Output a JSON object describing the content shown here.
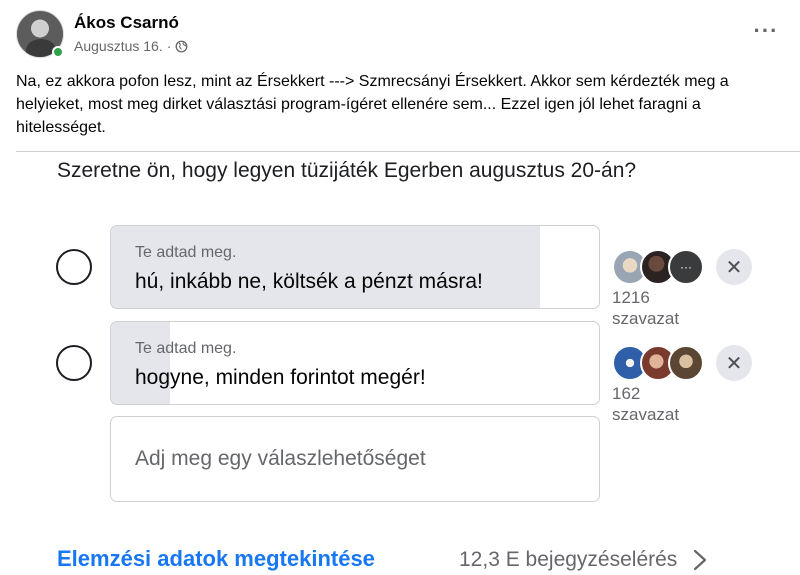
{
  "post": {
    "author": "Ákos Csarnó",
    "date": "Augusztus 16.",
    "date_separator": "·",
    "privacy_icon": "globe-icon",
    "more_label": "···",
    "text": "Na, ez akkora pofon lesz, mint az Érsekkert ---> Szmrecsányi Érsekkert. Akkor sem kérdezték meg a helyieket, most meg dirket választási program-ígéret ellenére sem... Ezzel igen jól lehet faragni a hitelességet."
  },
  "poll": {
    "question": "Szeretne ön, hogy legyen tüzijáték Egerben augusztus 20-án?",
    "options": [
      {
        "added_by": "Te adtad meg.",
        "text": "hú, inkább ne, költsék a pénzt másra!",
        "votes": "1216",
        "votes_label": "szavazat",
        "vote_share": 0.88,
        "remove_label": "✕"
      },
      {
        "added_by": "Te adtad meg.",
        "text": "hogyne, minden forintot megér!",
        "votes": "162",
        "votes_label": "szavazat",
        "vote_share": 0.12,
        "remove_label": "✕"
      }
    ],
    "add_option_placeholder": "Adj meg egy válaszlehetőséget"
  },
  "footer": {
    "insights_link": "Elemzési adatok megtekintése",
    "reach": "12,3 E bejegyzéselérés"
  },
  "colors": {
    "accent": "#1877f2",
    "online": "#31a24c",
    "muted_text": "#65676b",
    "fill": "#e4e6eb"
  }
}
